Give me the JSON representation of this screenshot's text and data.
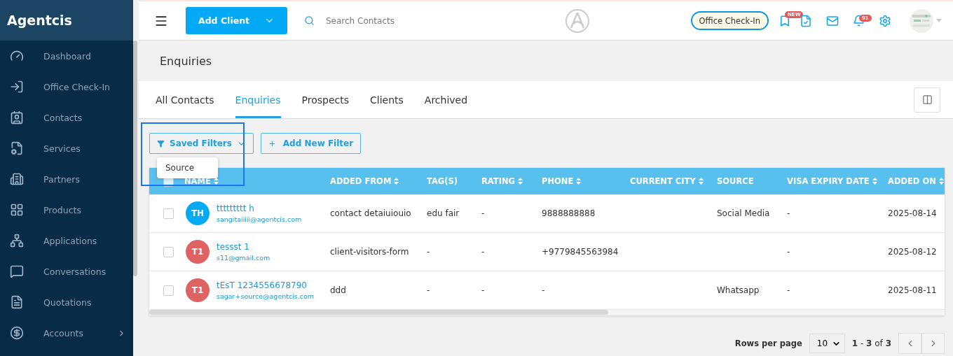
{
  "sidebar": {
    "brand": "Agentcis",
    "items": [
      {
        "label": "Dashboard",
        "has_submenu": false
      },
      {
        "label": "Office Check-In",
        "has_submenu": false
      },
      {
        "label": "Contacts",
        "has_submenu": false
      },
      {
        "label": "Services",
        "has_submenu": false
      },
      {
        "label": "Partners",
        "has_submenu": false
      },
      {
        "label": "Products",
        "has_submenu": false
      },
      {
        "label": "Applications",
        "has_submenu": false
      },
      {
        "label": "Conversations",
        "has_submenu": false
      },
      {
        "label": "Quotations",
        "has_submenu": false
      },
      {
        "label": "Accounts",
        "has_submenu": true
      }
    ]
  },
  "topbar": {
    "add_button": "Add Client",
    "search": {
      "placeholder": "Search Contacts"
    },
    "checkin_button": "Office Check-In",
    "new_badge": "NEW",
    "notification_count": "91"
  },
  "page": {
    "title": "Enquiries"
  },
  "tabs": [
    {
      "label": "All Contacts",
      "selected": false
    },
    {
      "label": "Enquiries",
      "selected": true
    },
    {
      "label": "Prospects",
      "selected": false
    },
    {
      "label": "Clients",
      "selected": false
    },
    {
      "label": "Archived",
      "selected": false
    }
  ],
  "filters": {
    "saved_button": "Saved Filters",
    "add_button": "Add New Filter",
    "menu_items": [
      "Source"
    ]
  },
  "table": {
    "all_checked": false,
    "columns": [
      {
        "label": "NAME",
        "sortable": true
      },
      {
        "label": "ADDED FROM",
        "sortable": true
      },
      {
        "label": "TAG(S)",
        "sortable": false
      },
      {
        "label": "RATING",
        "sortable": true
      },
      {
        "label": "PHONE",
        "sortable": true
      },
      {
        "label": "CURRENT CITY",
        "sortable": true
      },
      {
        "label": "SOURCE",
        "sortable": false
      },
      {
        "label": "VISA EXPIRY DATE",
        "sortable": true
      },
      {
        "label": "ADDED ON",
        "sortable": true
      }
    ],
    "rows": [
      {
        "checked": false,
        "cells": [
          {
            "initials": "TH",
            "color": "#03a9f4",
            "name": "ttttttttt h",
            "email": "sangitaiiiii@agentcis.com"
          },
          "contact detaiuiouio",
          "edu fair",
          "-",
          "9888888888",
          "",
          "Social Media",
          "-",
          "2025-08-14"
        ]
      },
      {
        "checked": false,
        "cells": [
          {
            "initials": "T1",
            "color": "#e06363",
            "name": "tessst 1",
            "email": "s11@gmail.com"
          },
          "client-visitors-form",
          "-",
          "-",
          "+9779845563984",
          "",
          "",
          "-",
          "2025-08-12"
        ]
      },
      {
        "checked": false,
        "cells": [
          {
            "initials": "T1",
            "color": "#e06363",
            "name": "tEsT 1234556678790",
            "email": "sagar+source@agentcis.com"
          },
          "ddd",
          "-",
          "-",
          "-",
          "",
          "Whatsapp",
          "-",
          "2025-08-11"
        ]
      }
    ]
  },
  "pagination": {
    "rows_label": "Rows per page",
    "rows_value": "10",
    "range": "**1** - **3** of **3**"
  }
}
